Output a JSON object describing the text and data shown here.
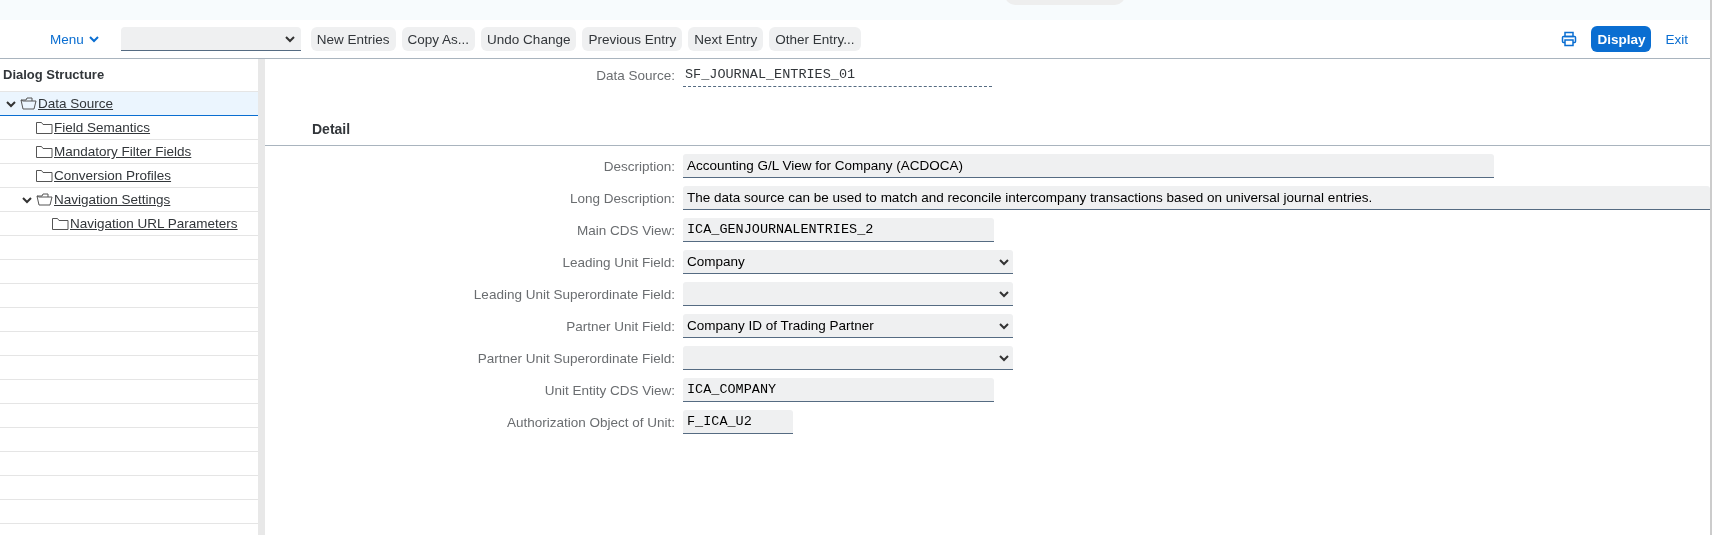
{
  "toolbar": {
    "menu": "Menu",
    "buttons": [
      "New Entries",
      "Copy As...",
      "Undo Change",
      "Previous Entry",
      "Next Entry",
      "Other Entry..."
    ],
    "display": "Display",
    "exit": "Exit"
  },
  "sidebar": {
    "title": "Dialog Structure",
    "items": [
      {
        "label": "Data Source",
        "selected": true,
        "expanded": true,
        "children": [
          {
            "label": "Field Semantics",
            "selected": false
          },
          {
            "label": "Mandatory Filter Fields",
            "selected": false
          },
          {
            "label": "Conversion Profiles",
            "selected": false
          },
          {
            "label": "Navigation Settings",
            "selected": false,
            "expanded": true,
            "children": [
              {
                "label": "Navigation URL Parameters",
                "selected": false
              }
            ]
          }
        ]
      }
    ]
  },
  "header": {
    "label": "Data Source:",
    "value": "SF_JOURNAL_ENTRIES_01"
  },
  "detail": {
    "title": "Detail",
    "fields": [
      {
        "label": "Description:",
        "value": "Accounting G/L View for Company (ACDOCA)",
        "kind": "text"
      },
      {
        "label": "Long Description:",
        "value": "The data source can be used to match and reconcile intercompany transactions based on universal journal entries.",
        "kind": "text"
      },
      {
        "label": "Main CDS View:",
        "value": "ICA_GENJOURNALENTRIES_2",
        "kind": "mono"
      },
      {
        "label": "Leading Unit Field:",
        "value": "Company",
        "kind": "select"
      },
      {
        "label": "Leading Unit Superordinate Field:",
        "kind": "select"
      },
      {
        "label": "Partner Unit Field:",
        "value": "Company ID of Trading Partner",
        "kind": "select"
      },
      {
        "label": "Partner Unit Superordinate Field:",
        "kind": "select"
      },
      {
        "label": "Unit Entity CDS View:",
        "value": "ICA_COMPANY",
        "kind": "mono"
      },
      {
        "label": "Authorization Object of Unit:",
        "value": "F_ICA_U2",
        "kind": "mono"
      }
    ]
  }
}
